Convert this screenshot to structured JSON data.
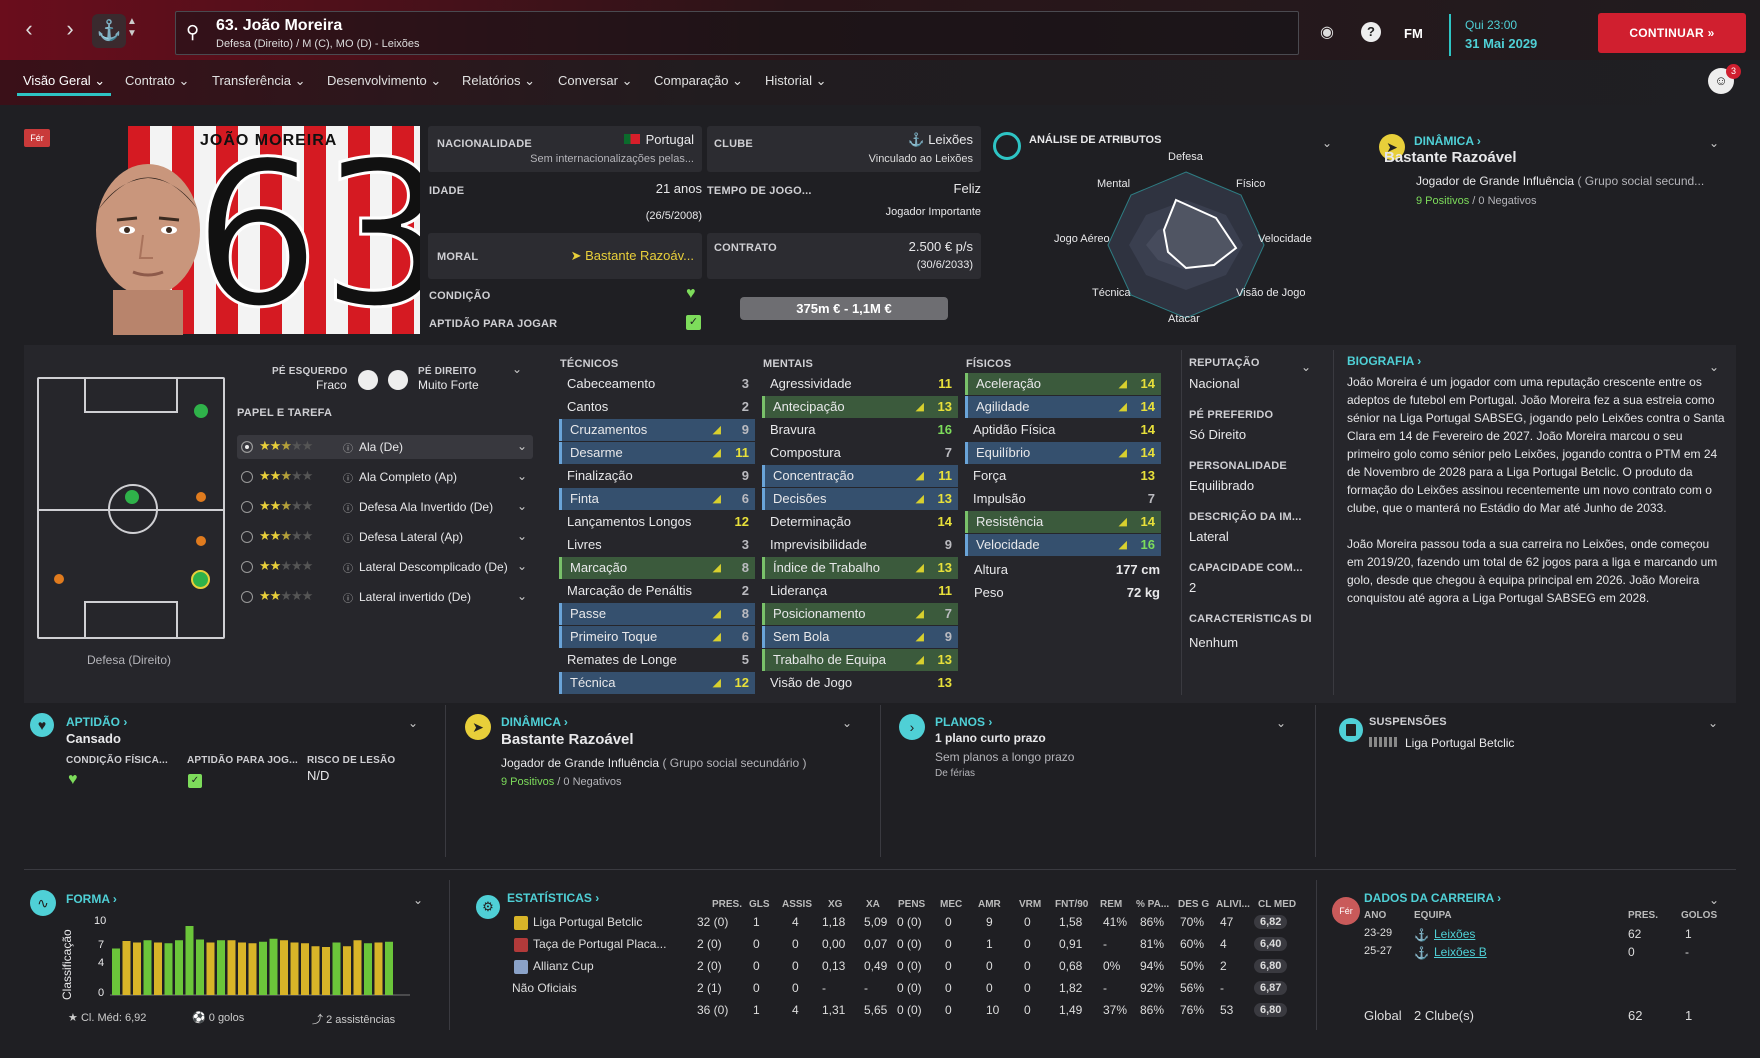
{
  "topbar": {
    "player_title": "63. João Moreira",
    "positions": "Defesa (Direito) / M (C), MO (D) - Leixões",
    "day": "Qui 23:00",
    "date": "31 Mai 2029",
    "continue_label": "CONTINUAR",
    "fm_label": "FM"
  },
  "nav_tabs": [
    "Visão Geral",
    "Contrato",
    "Transferência",
    "Desenvolvimento",
    "Relatórios",
    "Conversar",
    "Comparação",
    "Historial"
  ],
  "notif_count": "3",
  "injury_badge": "Fér",
  "shirt_name": "JOÃO MOREIRA",
  "shirt_number": "63",
  "info": {
    "nat_label": "NACIONALIDADE",
    "nat_val": "Portugal",
    "nat_sub": "Sem internacionalizações pelas...",
    "club_label": "CLUBE",
    "club_val": "Leixões",
    "club_sub": "Vinculado ao Leixões",
    "age_label": "IDADE",
    "age_val": "21 anos",
    "age_sub": "(26/5/2008)",
    "time_label": "TEMPO DE JOGO...",
    "time_val": "Feliz",
    "time_sub": "Jogador Importante",
    "morale_label": "MORAL",
    "morale_val": "Bastante Razoáv...",
    "contract_label": "CONTRATO",
    "contract_val": "2.500 € p/s",
    "contract_sub": "(30/6/2033)",
    "cond_label": "CONDIÇÃO",
    "fit_label": "APTIDÃO PARA JOGAR",
    "value": "375m € - 1,1M €"
  },
  "attr_analysis": {
    "title": "ANÁLISE DE ATRIBUTOS",
    "labels": [
      "Defesa",
      "Físico",
      "Velocidade",
      "Visão de Jogo",
      "Atacar",
      "Técnica",
      "Jogo Aéreo",
      "Mental"
    ]
  },
  "dyn_top": {
    "title": "DINÂMICA",
    "status": "Bastante Razoável",
    "desc": "Jogador de Grande Influência",
    "group": "( Grupo social secund...",
    "pos": "9 Positivos",
    "neg": "0 Negativos"
  },
  "feet": {
    "left_label": "PÉ ESQUERDO",
    "left_val": "Fraco",
    "right_label": "PÉ DIREITO",
    "right_val": "Muito Forte"
  },
  "role_title": "PAPEL E TAREFA",
  "roles": [
    {
      "name": "Ala (De)",
      "stars": 2.5
    },
    {
      "name": "Ala Completo (Ap)",
      "stars": 2.5
    },
    {
      "name": "Defesa Ala Invertido (De)",
      "stars": 2.5
    },
    {
      "name": "Defesa Lateral (Ap)",
      "stars": 2.5
    },
    {
      "name": "Lateral Descomplicado (De)",
      "stars": 2
    },
    {
      "name": "Lateral invertido (De)",
      "stars": 2
    }
  ],
  "pitch_caption": "Defesa (Direito)",
  "technical": {
    "title": "TÉCNICOS",
    "rows": [
      [
        "Cabeceamento",
        "3",
        ""
      ],
      [
        "Cantos",
        "2",
        ""
      ],
      [
        "Cruzamentos",
        "9",
        "b"
      ],
      [
        "Desarme",
        "11",
        "b"
      ],
      [
        "Finalização",
        "9",
        ""
      ],
      [
        "Finta",
        "6",
        "b"
      ],
      [
        "Lançamentos Longos",
        "12",
        ""
      ],
      [
        "Livres",
        "3",
        ""
      ],
      [
        "Marcação",
        "8",
        "g"
      ],
      [
        "Marcação de Penáltis",
        "2",
        ""
      ],
      [
        "Passe",
        "8",
        "b"
      ],
      [
        "Primeiro Toque",
        "6",
        "b"
      ],
      [
        "Remates de Longe",
        "5",
        ""
      ],
      [
        "Técnica",
        "12",
        "b"
      ]
    ]
  },
  "mental": {
    "title": "MENTAIS",
    "rows": [
      [
        "Agressividade",
        "11",
        ""
      ],
      [
        "Antecipação",
        "13",
        "g"
      ],
      [
        "Bravura",
        "16",
        ""
      ],
      [
        "Compostura",
        "7",
        ""
      ],
      [
        "Concentração",
        "11",
        "b"
      ],
      [
        "Decisões",
        "13",
        "b"
      ],
      [
        "Determinação",
        "14",
        ""
      ],
      [
        "Imprevisibilidade",
        "9",
        ""
      ],
      [
        "Índice de Trabalho",
        "13",
        "g"
      ],
      [
        "Liderança",
        "11",
        ""
      ],
      [
        "Posicionamento",
        "7",
        "g"
      ],
      [
        "Sem Bola",
        "9",
        "b"
      ],
      [
        "Trabalho de Equipa",
        "13",
        "g"
      ],
      [
        "Visão de Jogo",
        "13",
        ""
      ]
    ]
  },
  "physical": {
    "title": "FÍSICOS",
    "rows": [
      [
        "Aceleração",
        "14",
        "g"
      ],
      [
        "Agilidade",
        "14",
        "b"
      ],
      [
        "Aptidão Física",
        "14",
        ""
      ],
      [
        "Equilíbrio",
        "14",
        "b"
      ],
      [
        "Força",
        "13",
        ""
      ],
      [
        "Impulsão",
        "7",
        ""
      ],
      [
        "Resistência",
        "14",
        "g"
      ],
      [
        "Velocidade",
        "16",
        "b"
      ]
    ],
    "height_label": "Altura",
    "height": "177 cm",
    "weight_label": "Peso",
    "weight": "72 kg"
  },
  "side": {
    "rep_label": "REPUTAÇÃO",
    "rep": "Nacional",
    "foot_label": "PÉ PREFERIDO",
    "foot": "Só Direito",
    "pers_label": "PERSONALIDADE",
    "pers": "Equilibrado",
    "desc_label": "DESCRIÇÃO DA IM...",
    "desc": "Lateral",
    "cap_label": "CAPACIDADE COM...",
    "cap": "2",
    "char_label": "CARACTERÍSTICAS DI",
    "char": "Nenhum"
  },
  "bio": {
    "title": "BIOGRAFIA",
    "p1": "João Moreira é um jogador com uma reputação crescente entre os adeptos de futebol em Portugal. João Moreira fez a sua estreia como sénior na Liga Portugal SABSEG, jogando pelo Leixões contra o Santa Clara em 14 de Fevereiro de 2027. João Moreira marcou o seu primeiro golo como sénior pelo Leixões, jogando contra o PTM em 24 de Novembro de 2028 para a Liga Portugal Betclic. O produto da formação do Leixões assinou recentemente um novo contrato com o clube, que o manterá no Estádio do Mar até Junho de 2033.",
    "p2": "João Moreira passou toda a sua carreira no Leixões, onde começou em 2019/20, fazendo um total de 62 jogos para a liga e marcando um golo, desde que chegou à equipa principal em 2026. João Moreira conquistou até agora a Liga Portugal SABSEG em 2028."
  },
  "fitness": {
    "title": "APTIDÃO",
    "status": "Cansado",
    "c1": "CONDIÇÃO FÍSICA...",
    "c2": "APTIDÃO PARA JOG...",
    "c3": "RISCO DE LESÃO",
    "c3v": "N/D"
  },
  "dyn_mid": {
    "title": "DINÂMICA",
    "status": "Bastante Razoável",
    "desc": "Jogador de Grande Influência",
    "group": "( Grupo social secundário )",
    "pos": "9 Positivos",
    "neg": "0 Negativos"
  },
  "plans": {
    "title": "PLANOS",
    "status": "1 plano curto prazo",
    "sub": "Sem planos a longo prazo",
    "note": "De férias"
  },
  "susp": {
    "title": "SUSPENSÕES",
    "comp": "Liga Portugal Betclic"
  },
  "form": {
    "title": "FORMA",
    "ylabel": "Classificação",
    "ticks": [
      "10",
      "7",
      "4",
      "0"
    ],
    "avg": "Cl. Méd: 6,92",
    "goals": "0 golos",
    "assists": "2 assistências"
  },
  "chart_data": {
    "type": "bar",
    "ylabel": "Classificação",
    "ylim": [
      0,
      10
    ],
    "values": [
      6.2,
      7.2,
      7.0,
      7.3,
      7.0,
      6.9,
      7.3,
      9.2,
      7.4,
      7.0,
      7.3,
      7.3,
      7.0,
      6.9,
      7.1,
      7.5,
      7.3,
      7.0,
      6.9,
      6.5,
      6.4,
      7.0,
      6.5,
      7.3,
      6.9,
      7.0,
      7.1
    ],
    "colors": [
      "g",
      "y",
      "y",
      "g",
      "y",
      "g",
      "g",
      "g",
      "g",
      "y",
      "g",
      "y",
      "y",
      "y",
      "g",
      "g",
      "y",
      "y",
      "y",
      "y",
      "y",
      "g",
      "y",
      "y",
      "g",
      "y",
      "g"
    ]
  },
  "stats": {
    "title": "ESTATÍSTICAS",
    "headers": [
      "PRES.",
      "GLS",
      "ASSIS",
      "XG",
      "XA",
      "PENS",
      "MEC",
      "AMR",
      "VRM",
      "FNT/90",
      "REM",
      "% PA...",
      "DES G",
      "ALIVI...",
      "CL MED"
    ],
    "rows": [
      [
        "Liga Portugal Betclic",
        "32 (0)",
        "1",
        "4",
        "1,18",
        "5,09",
        "0 (0)",
        "0",
        "9",
        "0",
        "1,58",
        "41%",
        "86%",
        "70%",
        "47",
        "6,82"
      ],
      [
        "Taça de Portugal Placa...",
        "2 (0)",
        "0",
        "0",
        "0,00",
        "0,07",
        "0 (0)",
        "0",
        "1",
        "0",
        "0,91",
        "-",
        "81%",
        "60%",
        "4",
        "6,40"
      ],
      [
        "Allianz Cup",
        "2 (0)",
        "0",
        "0",
        "0,13",
        "0,49",
        "0 (0)",
        "0",
        "0",
        "0",
        "0,68",
        "0%",
        "94%",
        "50%",
        "2",
        "6,80"
      ],
      [
        "Não Oficiais",
        "2 (1)",
        "0",
        "0",
        "-",
        "-",
        "0 (0)",
        "0",
        "0",
        "0",
        "1,82",
        "-",
        "92%",
        "56%",
        "-",
        "6,87"
      ],
      [
        "",
        "36 (0)",
        "1",
        "4",
        "1,31",
        "5,65",
        "0 (0)",
        "0",
        "10",
        "0",
        "1,49",
        "37%",
        "86%",
        "76%",
        "53",
        "6,80"
      ]
    ]
  },
  "career": {
    "title": "DADOS DA CARREIRA",
    "h_year": "ANO",
    "h_team": "EQUIPA",
    "h_apps": "PRES.",
    "h_goals": "GOLOS",
    "rows": [
      [
        "23-29",
        "Leixões",
        "62",
        "1"
      ],
      [
        "25-27",
        "Leixões B",
        "0",
        "-"
      ]
    ],
    "total_label": "Global",
    "total_clubs": "2 Clube(s)",
    "total_apps": "62",
    "total_goals": "1"
  }
}
